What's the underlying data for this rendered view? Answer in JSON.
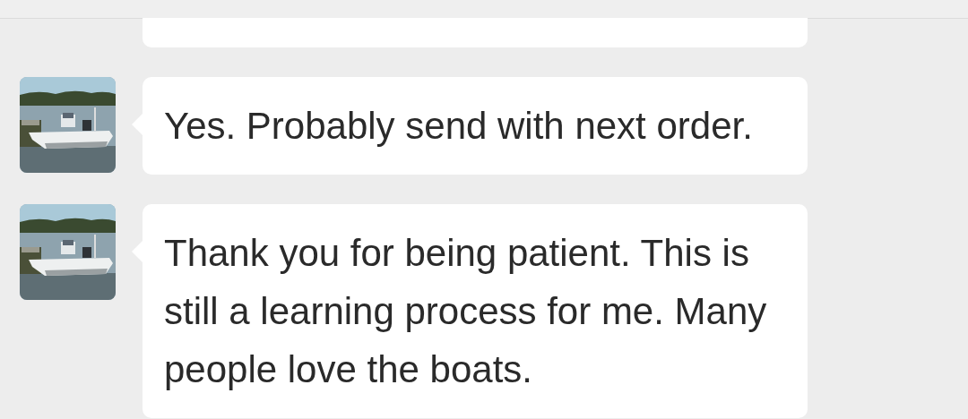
{
  "messages": [
    {
      "kind": "fragment"
    },
    {
      "kind": "text",
      "text": "Yes. Probably send with next order."
    },
    {
      "kind": "text",
      "text": "Thank you for being patient. This is still a learning process for me. Many people love the boats."
    }
  ]
}
